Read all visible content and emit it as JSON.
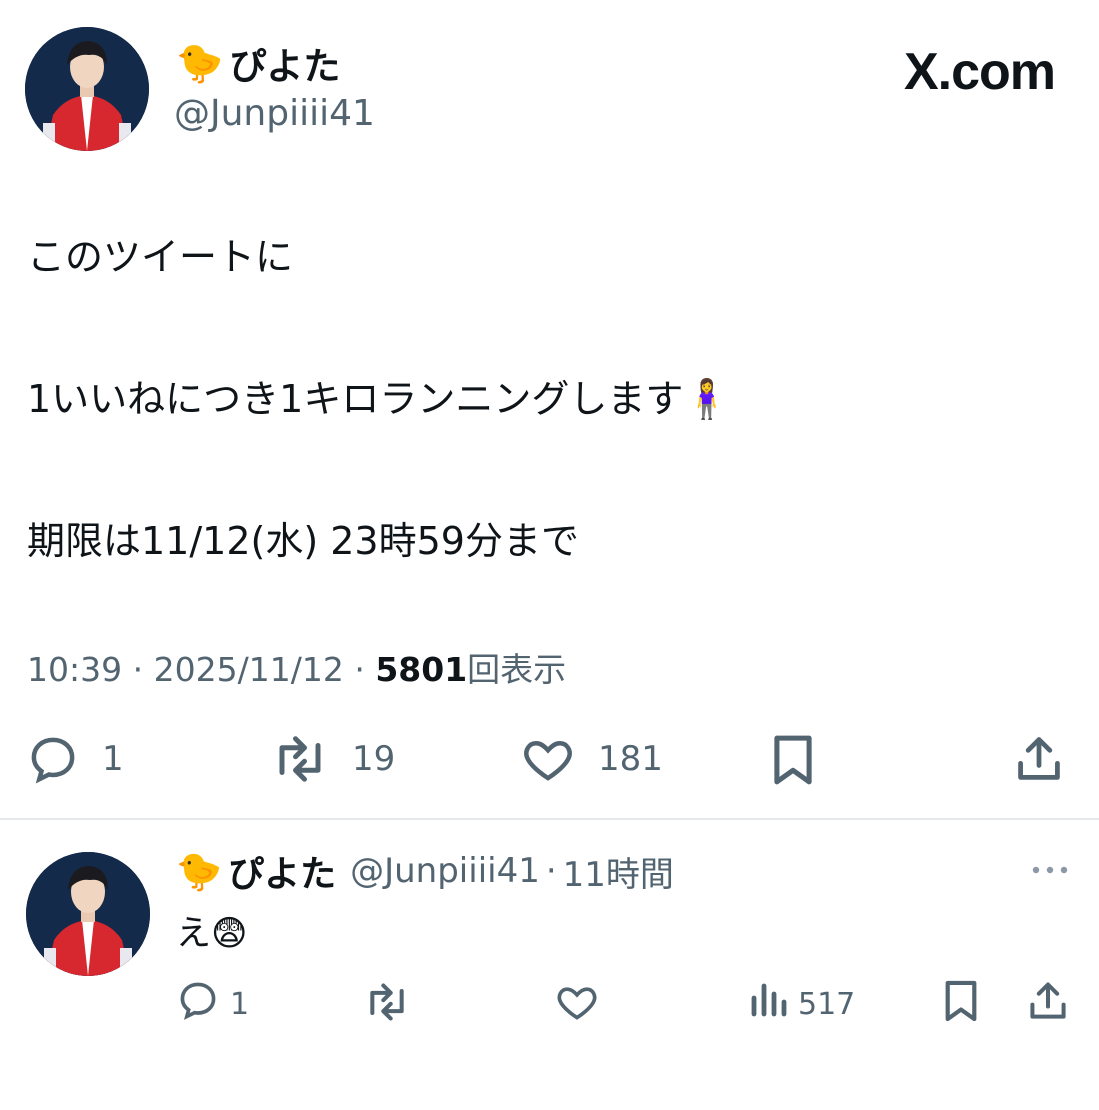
{
  "brand": "X.com",
  "main_tweet": {
    "author_emoji": "🐤",
    "display_name": "ぴよた",
    "handle": "@Junpiiii41",
    "lines": [
      "このツイートに",
      "1いいねにつき1キロランニングします🧍‍♀️",
      "期限は11/12(水) 23時59分まで"
    ],
    "time": "10:39",
    "date": "2025/11/12",
    "views_count": "5801",
    "views_label": "回表示",
    "separator": "·",
    "replies": "1",
    "reposts": "19",
    "likes": "181"
  },
  "reply_tweet": {
    "author_emoji": "🐤",
    "display_name": "ぴよた",
    "handle": "@Junpiiii41",
    "separator": "·",
    "time_ago": "11時間",
    "text": "え😨",
    "replies": "1",
    "views": "517"
  },
  "icons": [
    "reply-icon",
    "repost-icon",
    "like-icon",
    "bookmark-icon",
    "share-icon",
    "views-icon",
    "more-icon"
  ],
  "colors": {
    "text": "#0f1419",
    "secondary": "#536471",
    "divider": "#e6e9ec",
    "avatar_bg": "#142a4a",
    "jacket": "#d7282f"
  }
}
